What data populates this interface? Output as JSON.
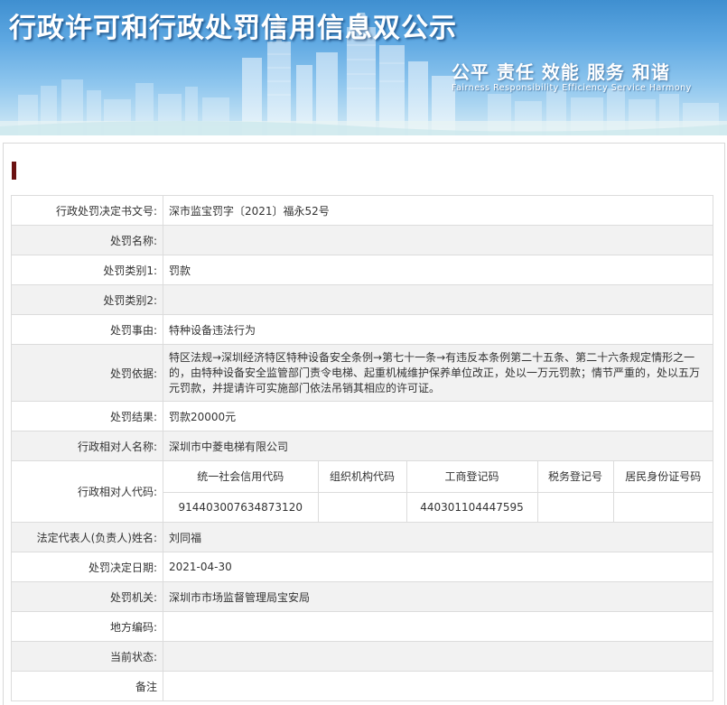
{
  "banner": {
    "title": "行政许可和行政处罚信用信息双公示",
    "slogan": "公平  责任  效能  服务  和谐",
    "slogan_en": "Fairness  Responsibility  Efficiency  Service  Harmony"
  },
  "record": {
    "doc_number_label": "行政处罚决定书文号:",
    "doc_number": "深市监宝罚字〔2021〕福永52号",
    "name_label": "处罚名称:",
    "name": "",
    "category1_label": "处罚类别1:",
    "category1": "罚款",
    "category2_label": "处罚类别2:",
    "category2": "",
    "reason_label": "处罚事由:",
    "reason": "特种设备违法行为",
    "basis_label": "处罚依据:",
    "basis": "特区法规→深圳经济特区特种设备安全条例→第七十一条→有违反本条例第二十五条、第二十六条规定情形之一的，由特种设备安全监管部门责令电梯、起重机械维护保养单位改正，处以一万元罚款；情节严重的，处以五万元罚款，并提请许可实施部门依法吊销其相应的许可证。",
    "result_label": "处罚结果:",
    "result": "罚款20000元",
    "party_name_label": "行政相对人名称:",
    "party_name": "深圳市中菱电梯有限公司",
    "party_code_label": "行政相对人代码:",
    "codes": {
      "headers": [
        "统一社会信用代码",
        "组织机构代码",
        "工商登记码",
        "税务登记号",
        "居民身份证号码"
      ],
      "values": [
        "914403007634873120",
        "",
        "440301104447595",
        "",
        ""
      ]
    },
    "legal_rep_label": "法定代表人(负责人)姓名:",
    "legal_rep": "刘同福",
    "decision_date_label": "处罚决定日期:",
    "decision_date": "2021-04-30",
    "authority_label": "处罚机关:",
    "authority": "深圳市市场监督管理局宝安局",
    "region_code_label": "地方编码:",
    "region_code": "",
    "status_label": "当前状态:",
    "status": "",
    "remarks_label": "备注",
    "remarks": ""
  }
}
